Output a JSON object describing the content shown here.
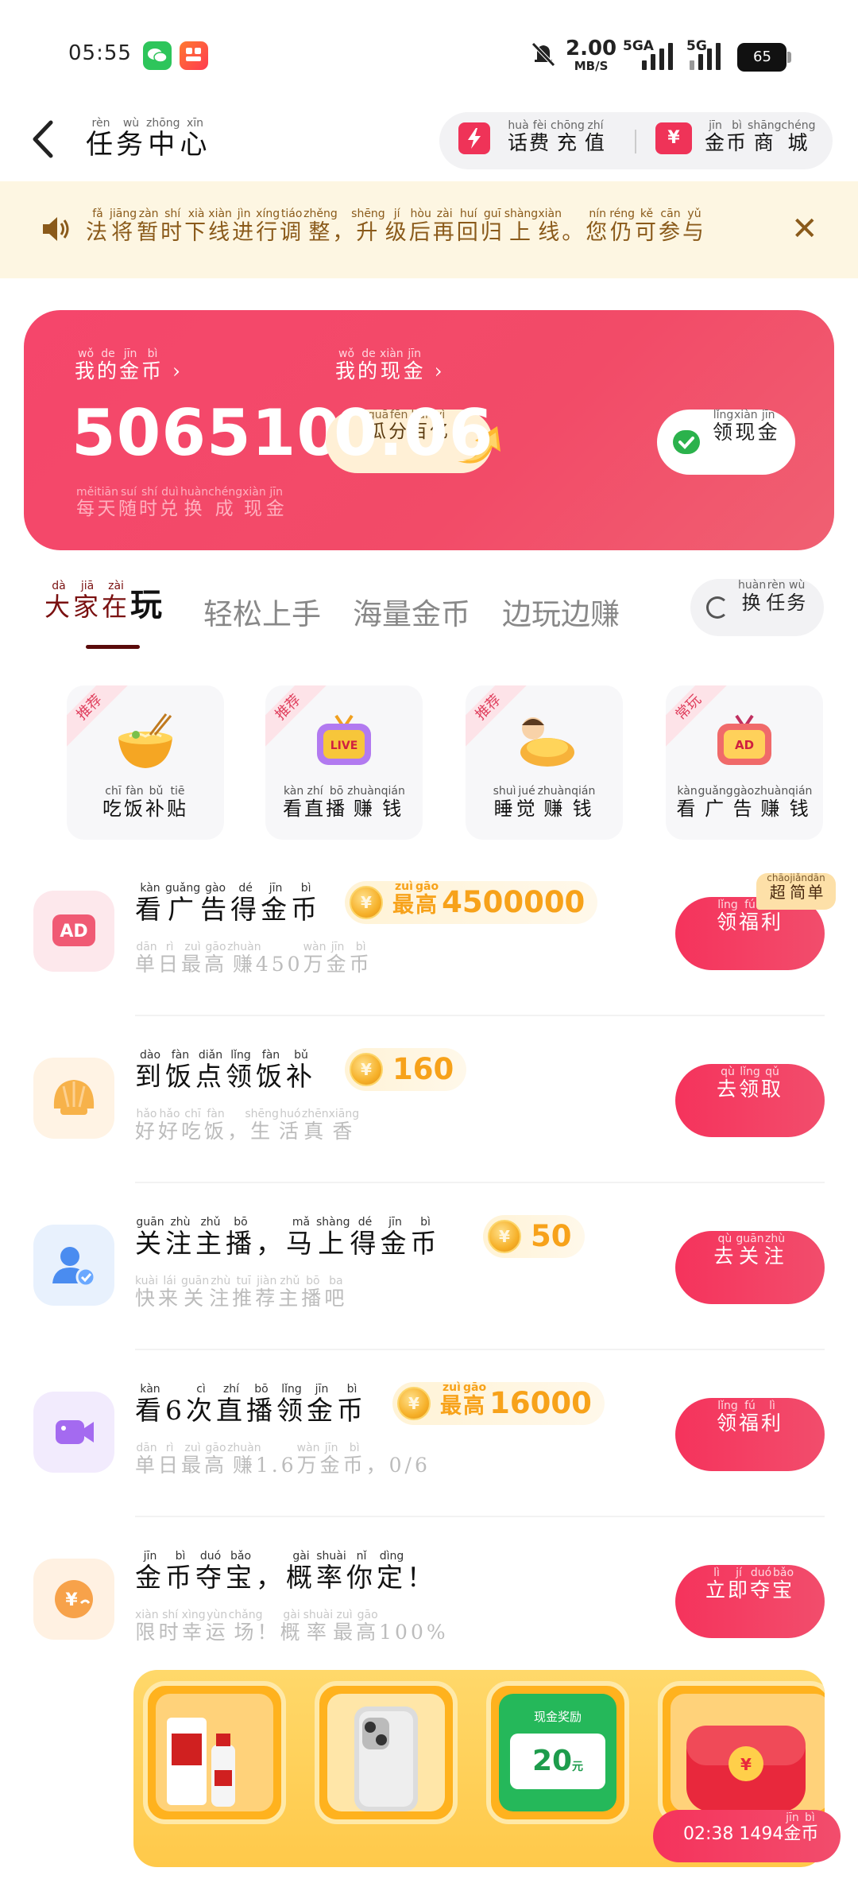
{
  "status": {
    "time": "05:55",
    "net_speed": "2.00",
    "net_unit": "MB/S",
    "sig1": "5GA",
    "sig2": "5G",
    "battery": "65"
  },
  "header": {
    "title": [
      [
        "任",
        "rèn"
      ],
      [
        "务",
        "wù"
      ],
      [
        "中",
        "zhōng"
      ],
      [
        "心",
        "xīn"
      ]
    ],
    "recharge": [
      [
        "话",
        "huà"
      ],
      [
        "费",
        "fèi"
      ],
      [
        "充",
        "chōng"
      ],
      [
        "值",
        "zhí"
      ]
    ],
    "mall": [
      [
        "金",
        "jīn"
      ],
      [
        "币",
        "bì"
      ],
      [
        "商",
        "shāng"
      ],
      [
        "城",
        "chéng"
      ]
    ],
    "recharge_icon": "lightning-icon",
    "mall_icon": "ticket-icon"
  },
  "notice": {
    "text": [
      [
        "",
        "",
        ""
      ],
      [
        "法",
        "fǎ"
      ],
      [
        "将",
        "jiāng"
      ],
      [
        "暂",
        "zàn"
      ],
      [
        "时",
        "shí"
      ],
      [
        "下",
        "xià"
      ],
      [
        "线",
        "xiàn"
      ],
      [
        "进",
        "jìn"
      ],
      [
        "行",
        "xíng"
      ],
      [
        "调",
        "tiáo"
      ],
      [
        "整",
        "zhěng"
      ],
      [
        "，",
        ""
      ],
      [
        "升",
        "shēng"
      ],
      [
        "级",
        "jí"
      ],
      [
        "后",
        "hòu"
      ],
      [
        "再",
        "zài"
      ],
      [
        "回",
        "huí"
      ],
      [
        "归",
        "guī"
      ],
      [
        "上",
        "shàng"
      ],
      [
        "线",
        "xiàn"
      ],
      [
        "。",
        ""
      ],
      [
        "您",
        "nín"
      ],
      [
        "仍",
        "réng"
      ],
      [
        "可",
        "kě"
      ],
      [
        "参",
        "cān"
      ],
      [
        "与",
        "yǔ"
      ]
    ]
  },
  "wallet": {
    "coins_label": [
      [
        "我",
        "wǒ"
      ],
      [
        "的",
        "de"
      ],
      [
        "金",
        "jīn"
      ],
      [
        "币",
        "bì"
      ]
    ],
    "coins_value": "506510",
    "cash_label": [
      [
        "我",
        "wǒ"
      ],
      [
        "的",
        "de"
      ],
      [
        "现",
        "xiàn"
      ],
      [
        "金",
        "jīn"
      ]
    ],
    "cash_value": "0.06",
    "guafen": [
      [
        "瓜",
        "guā"
      ],
      [
        "分",
        "fēn"
      ],
      [
        "百",
        "bǎi"
      ],
      [
        "亿",
        "yì"
      ]
    ],
    "lingxian": [
      [
        "领",
        "lǐng"
      ],
      [
        "现",
        "xiàn"
      ],
      [
        "金",
        "jīn"
      ]
    ],
    "sub": [
      [
        "每",
        "měi"
      ],
      [
        "天",
        "tiān"
      ],
      [
        "随",
        "suí"
      ],
      [
        "时",
        "shí"
      ],
      [
        "兑",
        "duì"
      ],
      [
        "换",
        "huàn"
      ],
      [
        "成",
        "chéng"
      ],
      [
        "现",
        "xiàn"
      ],
      [
        "金",
        "jīn"
      ]
    ]
  },
  "tabs": {
    "active": [
      [
        "大",
        "dà"
      ],
      [
        "家",
        "jiā"
      ],
      [
        "在",
        "zài"
      ]
    ],
    "active_tail": "玩",
    "t1": "轻松上手",
    "t2": "海量金币",
    "t3": "边玩边赚",
    "change": [
      [
        "换",
        "huàn"
      ],
      [
        "任",
        "rèn"
      ],
      [
        "务",
        "wù"
      ]
    ]
  },
  "cards": [
    {
      "ribbon": "推荐",
      "icon": "noodle-bowl-icon",
      "label": [
        [
          "吃",
          "chī"
        ],
        [
          "饭",
          "fàn"
        ],
        [
          "补",
          "bǔ"
        ],
        [
          "贴",
          "tiē"
        ]
      ]
    },
    {
      "ribbon": "推荐",
      "icon": "live-tv-icon",
      "label": [
        [
          "看",
          "kàn"
        ],
        [
          "直",
          "zhí"
        ],
        [
          "播",
          "bō"
        ],
        [
          "赚",
          "zhuàn"
        ],
        [
          "钱",
          "qián"
        ]
      ]
    },
    {
      "ribbon": "推荐",
      "icon": "sleeping-icon",
      "label": [
        [
          "睡",
          "shuì"
        ],
        [
          "觉",
          "jué"
        ],
        [
          "赚",
          "zhuàn"
        ],
        [
          "钱",
          "qián"
        ]
      ]
    },
    {
      "ribbon": "常玩",
      "icon": "ad-tv-icon",
      "label": [
        [
          "看",
          "kàn"
        ],
        [
          "广",
          "guǎng"
        ],
        [
          "告",
          "gào"
        ],
        [
          "赚",
          "zhuàn"
        ],
        [
          "钱",
          "qián"
        ]
      ]
    }
  ],
  "tasks": [
    {
      "icon": "ad-icon",
      "title": [
        [
          "看",
          "kàn"
        ],
        [
          "广",
          "guǎng"
        ],
        [
          "告",
          "gào"
        ],
        [
          "得",
          "dé"
        ],
        [
          "金",
          "jīn"
        ],
        [
          "币",
          "bì"
        ]
      ],
      "reward_prefix": [
        [
          "最",
          "zuì"
        ],
        [
          "高",
          "gāo"
        ]
      ],
      "reward": "4500000",
      "sub": [
        [
          "单",
          "dān"
        ],
        [
          "日",
          "rì"
        ],
        [
          "最",
          "zuì"
        ],
        [
          "高",
          "gāo"
        ],
        [
          "赚",
          "zhuàn"
        ],
        [
          "450",
          ""
        ],
        [
          "万",
          "wàn"
        ],
        [
          "金",
          "jīn"
        ],
        [
          "币",
          "bì"
        ]
      ],
      "button": [
        [
          "领",
          "lǐng"
        ],
        [
          "福",
          "fú"
        ],
        [
          "利",
          "lì"
        ]
      ],
      "badge": [
        [
          "超",
          "chāo"
        ],
        [
          "简",
          "jiǎn"
        ],
        [
          "单",
          "dān"
        ]
      ]
    },
    {
      "icon": "shell-icon",
      "title": [
        [
          "到",
          "dào"
        ],
        [
          "饭",
          "fàn"
        ],
        [
          "点",
          "diǎn"
        ],
        [
          "领",
          "lǐng"
        ],
        [
          "饭",
          "fàn"
        ],
        [
          "补",
          "bǔ"
        ]
      ],
      "reward": "160",
      "sub": [
        [
          "好",
          "hǎo"
        ],
        [
          "好",
          "hǎo"
        ],
        [
          "吃",
          "chī"
        ],
        [
          "饭",
          "fàn"
        ],
        [
          "，",
          ""
        ],
        [
          "生",
          "shēng"
        ],
        [
          "活",
          "huó"
        ],
        [
          "真",
          "zhēn"
        ],
        [
          "香",
          "xiāng"
        ]
      ],
      "button": [
        [
          "去",
          "qù"
        ],
        [
          "领",
          "lǐng"
        ],
        [
          "取",
          "qǔ"
        ]
      ]
    },
    {
      "icon": "follow-user-icon",
      "title": [
        [
          "关",
          "guān"
        ],
        [
          "注",
          "zhù"
        ],
        [
          "主",
          "zhǔ"
        ],
        [
          "播",
          "bō"
        ],
        [
          "，",
          ""
        ],
        [
          "马",
          "mǎ"
        ],
        [
          "上",
          "shàng"
        ],
        [
          "得",
          "dé"
        ],
        [
          "金",
          "jīn"
        ],
        [
          "币",
          "bì"
        ]
      ],
      "reward": "50",
      "sub": [
        [
          "快",
          "kuài"
        ],
        [
          "来",
          "lái"
        ],
        [
          "关",
          "guān"
        ],
        [
          "注",
          "zhù"
        ],
        [
          "推",
          "tuī"
        ],
        [
          "荐",
          "jiàn"
        ],
        [
          "主",
          "zhǔ"
        ],
        [
          "播",
          "bō"
        ],
        [
          "吧",
          "ba"
        ]
      ],
      "button": [
        [
          "去",
          "qù"
        ],
        [
          "关",
          "guān"
        ],
        [
          "注",
          "zhù"
        ]
      ]
    },
    {
      "icon": "video-camera-icon",
      "title": [
        [
          "看",
          "kàn"
        ],
        [
          "6",
          ""
        ],
        [
          "次",
          "cì"
        ],
        [
          "直",
          "zhí"
        ],
        [
          "播",
          "bō"
        ],
        [
          "领",
          "lǐng"
        ],
        [
          "金",
          "jīn"
        ],
        [
          "币",
          "bì"
        ]
      ],
      "reward_prefix": [
        [
          "最",
          "zuì"
        ],
        [
          "高",
          "gāo"
        ]
      ],
      "reward": "16000",
      "sub": [
        [
          "单",
          "dān"
        ],
        [
          "日",
          "rì"
        ],
        [
          "最",
          "zuì"
        ],
        [
          "高",
          "gāo"
        ],
        [
          "赚",
          "zhuàn"
        ],
        [
          "1.6",
          ""
        ],
        [
          "万",
          "wàn"
        ],
        [
          "金",
          "jīn"
        ],
        [
          "币",
          "bì"
        ],
        [
          "，0/6",
          ""
        ]
      ],
      "button": [
        [
          "领",
          "lǐng"
        ],
        [
          "福",
          "fú"
        ],
        [
          "利",
          "lì"
        ]
      ]
    },
    {
      "icon": "treasure-coin-icon",
      "title": [
        [
          "金",
          "jīn"
        ],
        [
          "币",
          "bì"
        ],
        [
          "夺",
          "duó"
        ],
        [
          "宝",
          "bǎo"
        ],
        [
          "，",
          ""
        ],
        [
          "概",
          "gài"
        ],
        [
          "率",
          "shuài"
        ],
        [
          "你",
          "nǐ"
        ],
        [
          "定",
          "dìng"
        ],
        [
          "！",
          ""
        ]
      ],
      "sub": [
        [
          "限",
          "xiàn"
        ],
        [
          "时",
          "shí"
        ],
        [
          "幸",
          "xìng"
        ],
        [
          "运",
          "yùn"
        ],
        [
          "场",
          "chǎng"
        ],
        [
          "！",
          ""
        ],
        [
          "概",
          "gài"
        ],
        [
          "率",
          "shuài"
        ],
        [
          "最",
          "zuì"
        ],
        [
          "高",
          "gāo"
        ],
        [
          "100%",
          ""
        ]
      ],
      "button": [
        [
          "立",
          "lì"
        ],
        [
          "即",
          "jí"
        ],
        [
          "夺",
          "duó"
        ],
        [
          "宝",
          "bǎo"
        ]
      ]
    }
  ],
  "prizes": {
    "items": [
      "liquor-bottle-icon",
      "smartphone-icon",
      "cash-reward-icon",
      "red-treasure-chest-icon"
    ],
    "cash_title": "现金奖励",
    "cash_amount": "20",
    "cash_unit": "元"
  },
  "float": {
    "timer": "02:38",
    "amount": "1494",
    "unit": [
      [
        "金",
        "jīn"
      ],
      [
        "币",
        "bì"
      ]
    ]
  },
  "colors": {
    "accent": "#f2406a",
    "gold": "#f7a21a",
    "notice_bg": "#fdf6e2"
  }
}
